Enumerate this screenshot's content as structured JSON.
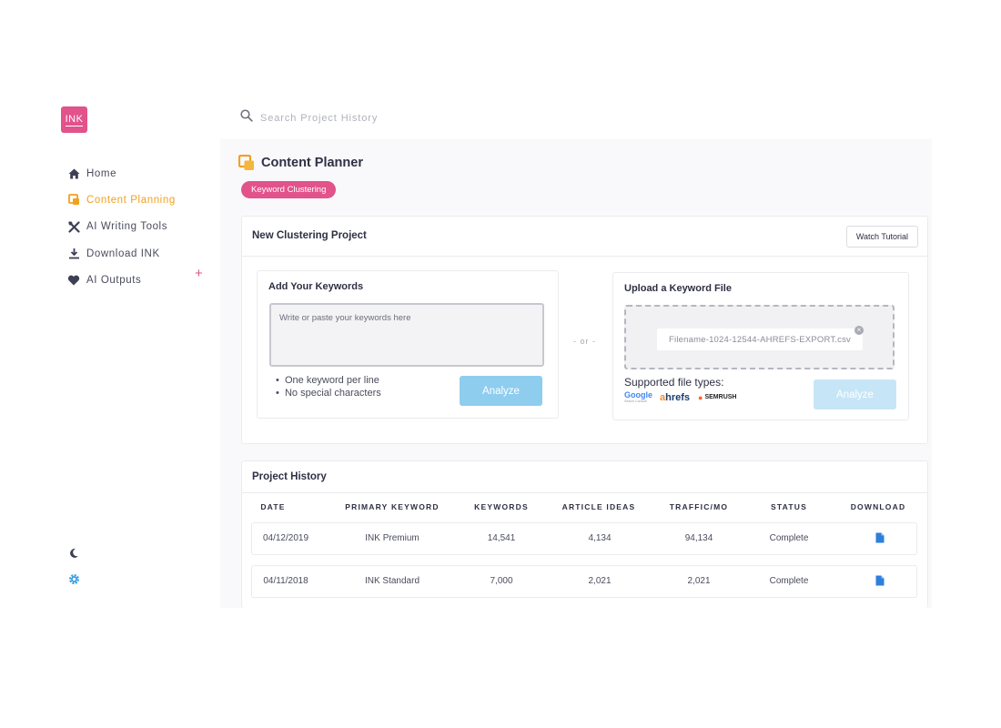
{
  "app": {
    "logo_text": "INK",
    "brand_color": "#e2528b",
    "accent_color": "#f0a11f",
    "button_color": "#8fcdef"
  },
  "search": {
    "placeholder": "Search Project History",
    "icon": "search-icon"
  },
  "sidebar": {
    "items": [
      {
        "label": "Home",
        "icon": "home-icon",
        "active": false
      },
      {
        "label": "Content Planning",
        "icon": "content-planning-icon",
        "active": true
      },
      {
        "label": "AI Writing Tools",
        "icon": "tools-icon",
        "active": false
      },
      {
        "label": "Download INK",
        "icon": "download-icon",
        "active": false
      },
      {
        "label": "AI Outputs",
        "icon": "heart-icon",
        "active": false
      }
    ],
    "add_icon": "plus-icon",
    "bottom_icons": [
      "moon-icon",
      "gear-icon"
    ]
  },
  "page": {
    "title": "Content Planner",
    "tag": "Keyword Clustering"
  },
  "new_project": {
    "title": "New Clustering Project",
    "tutorial_label": "Watch Tutorial",
    "keywords_panel": {
      "title": "Add Your Keywords",
      "placeholder": "Write or paste your keywords here",
      "rules": [
        "One keyword per line",
        "No special characters"
      ],
      "analyze_label": "Analyze"
    },
    "or_label": "- or -",
    "upload_panel": {
      "title": "Upload a Keyword File",
      "filename": "Filename-1024-12544-AHREFS-EXPORT.csv",
      "supported_label": "Supported file types:",
      "file_types": {
        "google": "Google",
        "google_sub": "Search Console",
        "ahrefs_a": "a",
        "ahrefs_rest": "hrefs",
        "semrush": "SEMRUSH"
      },
      "analyze_label": "Analyze"
    }
  },
  "history": {
    "title": "Project History",
    "columns": [
      "DATE",
      "PRIMARY KEYWORD",
      "KEYWORDS",
      "ARTICLE IDEAS",
      "TRAFFIC/MO",
      "STATUS",
      "DOWNLOAD"
    ],
    "rows": [
      {
        "date": "04/12/2019",
        "keyword": "INK Premium",
        "keywords": "14,541",
        "ideas": "4,134",
        "traffic": "94,134",
        "status": "Complete"
      },
      {
        "date": "04/11/2018",
        "keyword": "INK Standard",
        "keywords": "7,000",
        "ideas": "2,021",
        "traffic": "2,021",
        "status": "Complete"
      }
    ]
  }
}
